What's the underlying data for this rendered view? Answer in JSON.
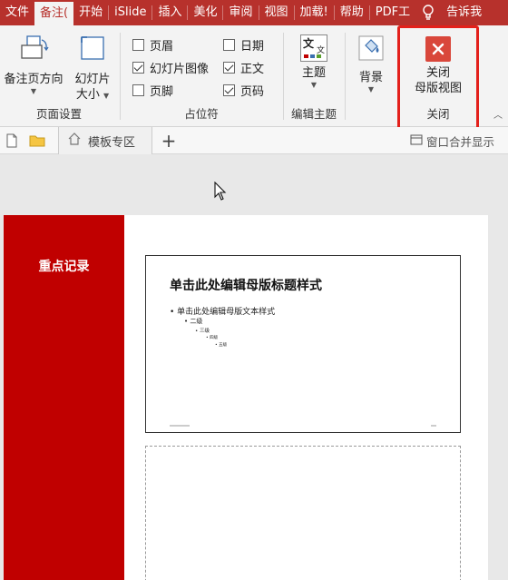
{
  "ribbon_tabs": [
    "文件",
    "备注(",
    "开始",
    "iSlide",
    "插入",
    "美化",
    "审阅",
    "视图",
    "加载!",
    "帮助",
    "PDF工",
    "告诉我"
  ],
  "groups": {
    "page_setup": {
      "label": "页面设置",
      "note_orientation": "备注页方向",
      "slide_size_line1": "幻灯片",
      "slide_size_line2": "大小"
    },
    "placeholders": {
      "label": "占位符",
      "header": "页眉",
      "slide_image": "幻灯片图像",
      "footer": "页脚",
      "date": "日期",
      "body": "正文",
      "page_number": "页码"
    },
    "edit_theme": {
      "label": "编辑主题",
      "theme": "主题",
      "theme_icon_text": "文"
    },
    "background": {
      "label": "背景"
    },
    "close": {
      "label": "关闭",
      "close_line1": "关闭",
      "close_line2": "母版视图"
    }
  },
  "checkboxes": {
    "header": false,
    "slide_image": true,
    "footer": false,
    "date": false,
    "body": true,
    "page_number": true
  },
  "doc_tab": "模板专区",
  "merge_display": "窗口合并显示",
  "notes_page": {
    "side_title": "重点记录",
    "slide_title": "单击此处编辑母版标题样式",
    "levels": [
      "• 单击此处编辑母版文本样式",
      "• 二级",
      "• 三级",
      "• 四级",
      "• 五级"
    ]
  },
  "colors": {
    "brand": "#b7312c",
    "accent_red": "#c00000",
    "highlight": "#e3201b"
  }
}
